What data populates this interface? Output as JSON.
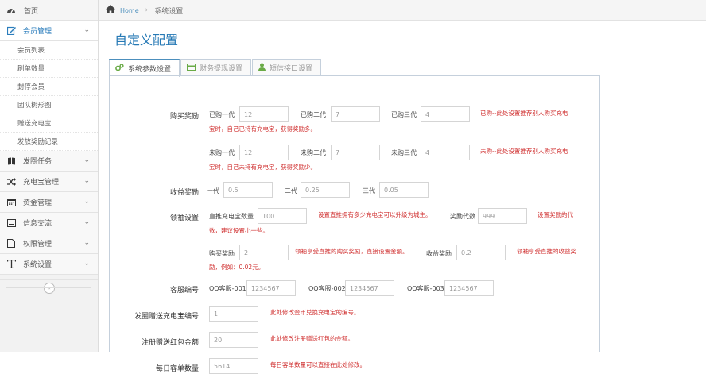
{
  "nav": {
    "home_label": "首页"
  },
  "breadcrumb": {
    "home": "Home",
    "separator": "›",
    "current": "系统设置"
  },
  "sidebar": {
    "member": {
      "label": "会员管理"
    },
    "sub_items": [
      "会员列表",
      "刷单数量",
      "封停会员",
      "团队树形图",
      "赠送充电宝",
      "发放奖励记录"
    ],
    "menus": [
      {
        "label": "发圈任务"
      },
      {
        "label": "充电宝管理"
      },
      {
        "label": "资金管理"
      },
      {
        "label": "信息交流"
      },
      {
        "label": "权限管理"
      },
      {
        "label": "系统设置"
      }
    ],
    "collapse_glyph": "«"
  },
  "page": {
    "title": "自定义配置"
  },
  "tabs": [
    {
      "label": "系统参数设置",
      "icon": "cogs-icon"
    },
    {
      "label": "财务提现设置",
      "icon": "credit-card-icon"
    },
    {
      "label": "短信接口设置",
      "icon": "user-icon"
    }
  ],
  "form": {
    "purchase": {
      "label": "购买奖励",
      "bought": {
        "l1": "已购一代",
        "v1": "12",
        "l2": "已购二代",
        "v2": "7",
        "l3": "已购三代",
        "v3": "4",
        "hint1": "已购--此处设置推荐别人购买充电",
        "hint2": "宝时，自己已持有充电宝，获得奖励多。"
      },
      "not_bought": {
        "l1": "未购一代",
        "v1": "12",
        "l2": "未购二代",
        "v2": "7",
        "l3": "未购三代",
        "v3": "4",
        "hint1": "未购--此处设置推荐别人购买充电",
        "hint2": "宝时，自己未持有充电宝，获得奖励少。"
      }
    },
    "income": {
      "label": "收益奖励",
      "l1": "一代",
      "v1": "0.5",
      "l2": "二代",
      "v2": "0.25",
      "l3": "三代",
      "v3": "0.05"
    },
    "leader": {
      "label": "领袖设置",
      "direct_label": "直推充电宝数量",
      "direct_value": "100",
      "hint_a": "设置直推拥有多少充电宝可以升级为城主。",
      "gen_label": "奖励代数",
      "gen_value": "999",
      "hint_b1": "设置奖励的代",
      "hint_b2": "数，建议设置小一些。",
      "buy_label": "购买奖励",
      "buy_value": "2",
      "hint_c": "领袖享受直推的购买奖励，直接设置金额。",
      "earn_label": "收益奖励",
      "earn_value": "0.2",
      "hint_d1": "领袖享受直推的收益奖",
      "hint_d2": "励，例如：0.02元。"
    },
    "service": {
      "label": "客服编号",
      "l1": "QQ客服-001",
      "v1": "1234567",
      "l2": "QQ客服-002",
      "v2": "1234567",
      "l3": "QQ客服-003",
      "v3": "1234567"
    },
    "circle": {
      "label": "发圈赠送充电宝编号",
      "value": "1",
      "hint": "此处修改金币兑换充电宝的编号。"
    },
    "register": {
      "label": "注册赠送红包金额",
      "value": "20",
      "hint": "此处修改注册赠送红包的金额。"
    },
    "daily": {
      "label": "每日客单数量",
      "value": "5614",
      "hint": "每日客单数量可以直接在此处修改。"
    }
  },
  "colors": {
    "accent": "#2679b5",
    "hint": "#d03131",
    "tab_border": "#c5d0dc"
  }
}
